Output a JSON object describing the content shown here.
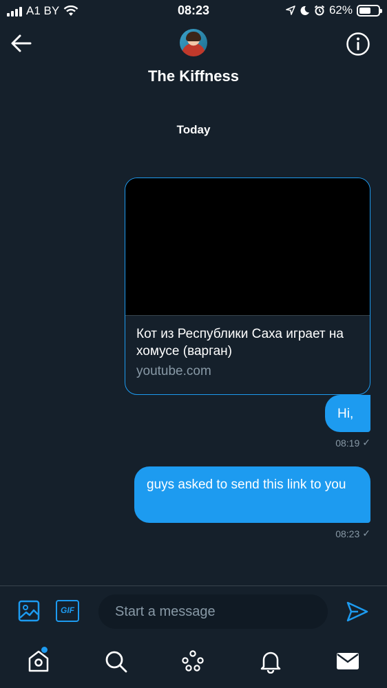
{
  "status_bar": {
    "carrier": "A1 BY",
    "time": "08:23",
    "battery": "62%",
    "battery_level": 0.62
  },
  "header": {
    "title": "The Kiffness"
  },
  "conversation": {
    "date_label": "Today",
    "link_card": {
      "title": "Кот из Республики Саха играет на хомусе (варган)",
      "domain": "youtube.com"
    },
    "messages": [
      {
        "text": "Hi,",
        "time": "08:19",
        "status": "✓"
      },
      {
        "text": "guys asked to send this link to you",
        "time": "08:23",
        "status": "✓"
      }
    ]
  },
  "composer": {
    "gif_label": "GIF",
    "placeholder": "Start a message"
  },
  "icons": {
    "back": "arrow-left-icon",
    "info": "info-icon",
    "media": "image-icon",
    "send": "send-icon",
    "home": "home-icon",
    "search": "search-icon",
    "spaces": "spaces-icon",
    "notifications": "bell-icon",
    "messages": "envelope-icon"
  },
  "colors": {
    "background": "#15202b",
    "accent": "#1d9bf0",
    "secondary_text": "#8899a6"
  }
}
